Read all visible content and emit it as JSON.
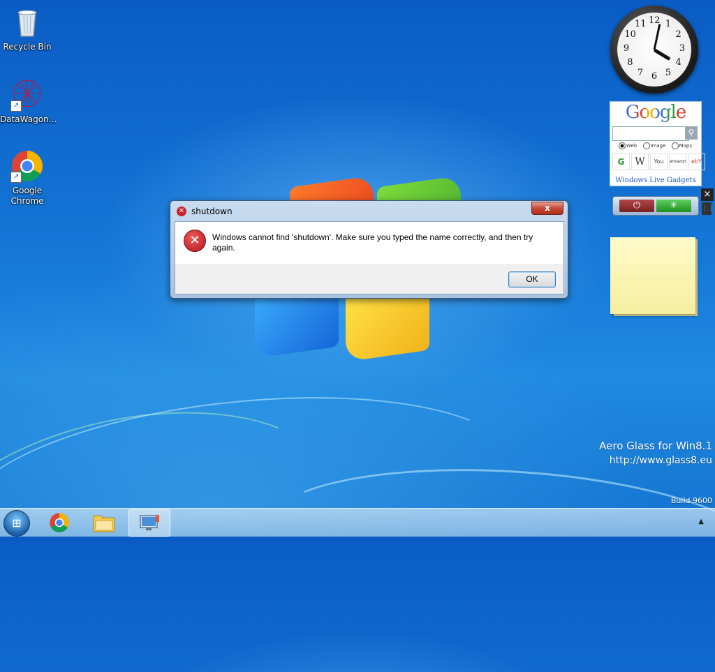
{
  "desktop": {
    "icons": [
      {
        "label": "Recycle Bin",
        "icon": "recycle-bin-icon"
      },
      {
        "label": "DataWagon…",
        "icon": "datawagon-icon"
      },
      {
        "label": "Google Chrome",
        "icon": "chrome-icon"
      }
    ],
    "watermark": {
      "line1": "Aero Glass for Win8.1",
      "line2": "http://www.glass8.eu",
      "build": "Build 9600"
    }
  },
  "gadgets": {
    "clock": {
      "numbers": [
        "12",
        "1",
        "2",
        "3",
        "4",
        "5",
        "6",
        "7",
        "8",
        "9",
        "10",
        "11"
      ],
      "hour": 4,
      "minute": 2
    },
    "google": {
      "logo": "Google",
      "search_value": "",
      "search_button_icon": "magnifier-icon",
      "options": [
        "Web",
        "Image",
        "Maps"
      ],
      "selected_option": "Web",
      "links": [
        "G",
        "W",
        "You",
        "amazon",
        "ebY"
      ],
      "footer": "Windows Live Gadgets"
    },
    "close_glyph": "×",
    "grip_glyph": "⋮⋮",
    "power": {
      "off_glyph": "⏻",
      "on_glyph": "✳"
    }
  },
  "dialog": {
    "title": "shutdown",
    "title_icon_glyph": "✕",
    "close_glyph": "x",
    "icon_glyph": "✕",
    "message": "Windows cannot find 'shutdown'. Make sure you typed the name correctly, and then try again.",
    "ok_label": "OK"
  },
  "taskbar": {
    "start_glyph": "⊞",
    "items": [
      {
        "icon": "chrome-icon",
        "glyph": "◎"
      },
      {
        "icon": "file-explorer-icon",
        "glyph": "▤"
      },
      {
        "icon": "remote-desktop-icon",
        "glyph": "▣"
      }
    ],
    "tray_arrow": "▲"
  },
  "colors": {
    "desktop": "#1476d6",
    "dialog_close": "#c44a33",
    "error_red": "#c9252b"
  }
}
